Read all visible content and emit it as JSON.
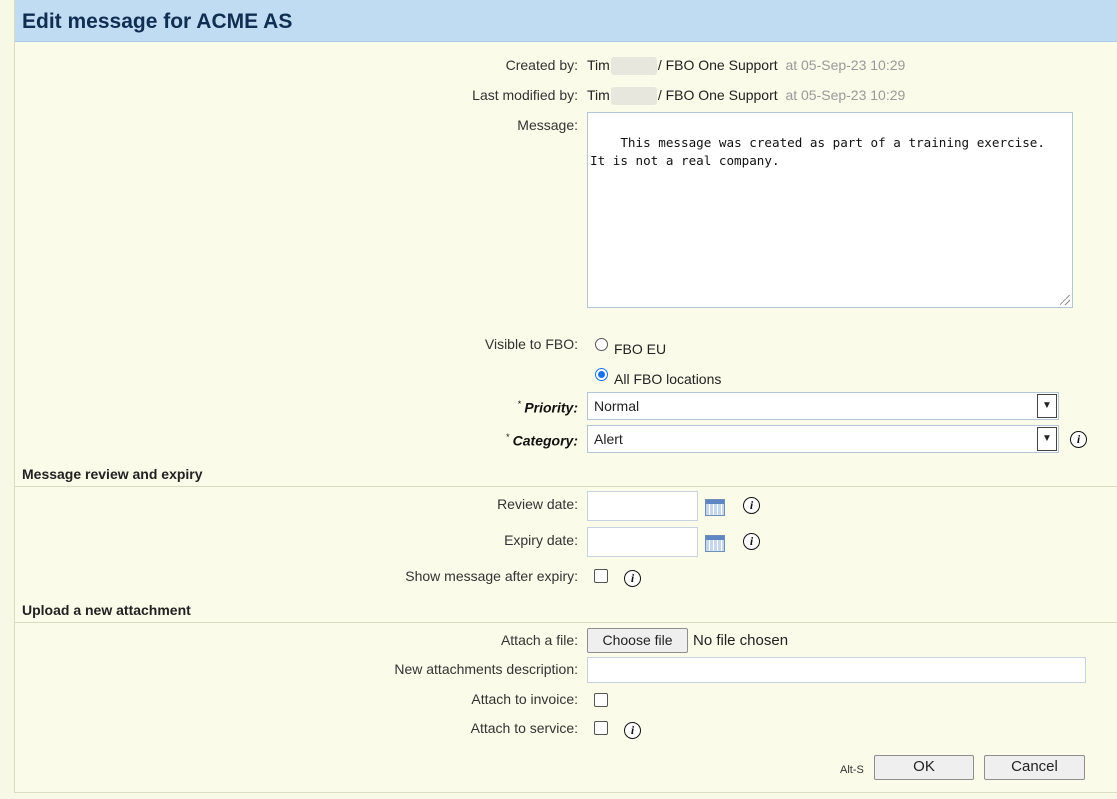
{
  "header": {
    "title": "Edit message for ACME AS"
  },
  "meta": {
    "created_by_label": "Created by:",
    "created_by_first": "Tim",
    "created_by_org": "/ FBO One Support",
    "created_at": "at 05-Sep-23 10:29",
    "modified_by_label": "Last modified by:",
    "modified_by_first": "Tim",
    "modified_by_org": "/ FBO One Support",
    "modified_at": "at 05-Sep-23 10:29"
  },
  "message": {
    "label": "Message:",
    "text": "This message was created as part of a training exercise.\nIt is not a real company."
  },
  "visibility": {
    "label": "Visible to FBO:",
    "options": [
      {
        "label": "FBO EU",
        "selected": false
      },
      {
        "label": "All FBO locations",
        "selected": true
      }
    ]
  },
  "priority": {
    "required_mark": "*",
    "label": "Priority:",
    "value": "Normal"
  },
  "category": {
    "required_mark": "*",
    "label": "Category:",
    "value": "Alert"
  },
  "review_section": {
    "title": "Message review and expiry",
    "review_date_label": "Review date:",
    "review_date_value": "",
    "expiry_date_label": "Expiry date:",
    "expiry_date_value": "",
    "show_after_expiry_label": "Show message after expiry:",
    "show_after_expiry_checked": false
  },
  "attachment_section": {
    "title": "Upload a new attachment",
    "attach_file_label": "Attach a file:",
    "choose_file_button": "Choose file",
    "no_file_text": "No file chosen",
    "description_label": "New attachments description:",
    "description_value": "",
    "attach_invoice_label": "Attach to invoice:",
    "attach_invoice_checked": false,
    "attach_service_label": "Attach to service:",
    "attach_service_checked": false
  },
  "footer": {
    "shortcut_hint": "Alt-S",
    "ok_label": "OK",
    "cancel_label": "Cancel"
  },
  "icons": {
    "info": "info-icon",
    "calendar": "calendar-icon",
    "dropdown": "chevron-down-icon"
  },
  "colors": {
    "title_bar": "#bfdcf2",
    "title_text": "#102d52",
    "page_background": "#fafbe8",
    "radio_accent": "#1a73e8"
  }
}
